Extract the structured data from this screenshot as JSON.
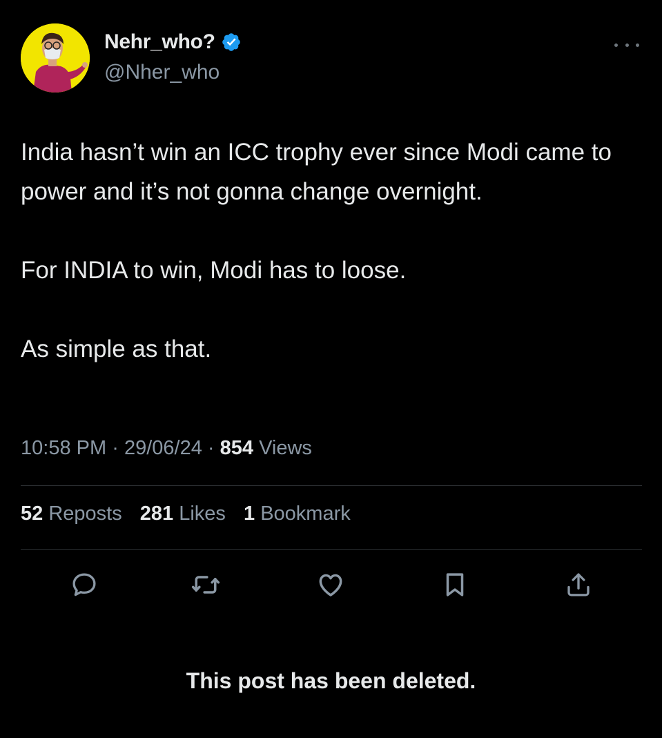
{
  "author": {
    "display_name": "Nehr_who?",
    "handle": "@Nher_who",
    "verified": true,
    "verified_color": "#1d9bf0",
    "avatar_bg_color": "#f2e500"
  },
  "tweet": {
    "paragraphs": [
      "India hasn’t win an ICC trophy ever since Modi came to power and it’s not gonna change overnight.",
      "For INDIA to win, Modi has to loose.",
      "As simple as that."
    ],
    "time": "10:58 PM",
    "date": "29/06/24",
    "views_count": "854",
    "views_label": "Views",
    "separator": "·"
  },
  "stats": {
    "reposts_count": "52",
    "reposts_label": "Reposts",
    "likes_count": "281",
    "likes_label": "Likes",
    "bookmarks_count": "1",
    "bookmarks_label": "Bookmark"
  },
  "actions": [
    {
      "name": "reply-icon"
    },
    {
      "name": "repost-icon"
    },
    {
      "name": "like-icon"
    },
    {
      "name": "bookmark-icon"
    },
    {
      "name": "share-icon"
    }
  ],
  "footer": {
    "deleted_notice": "This post has been deleted."
  }
}
